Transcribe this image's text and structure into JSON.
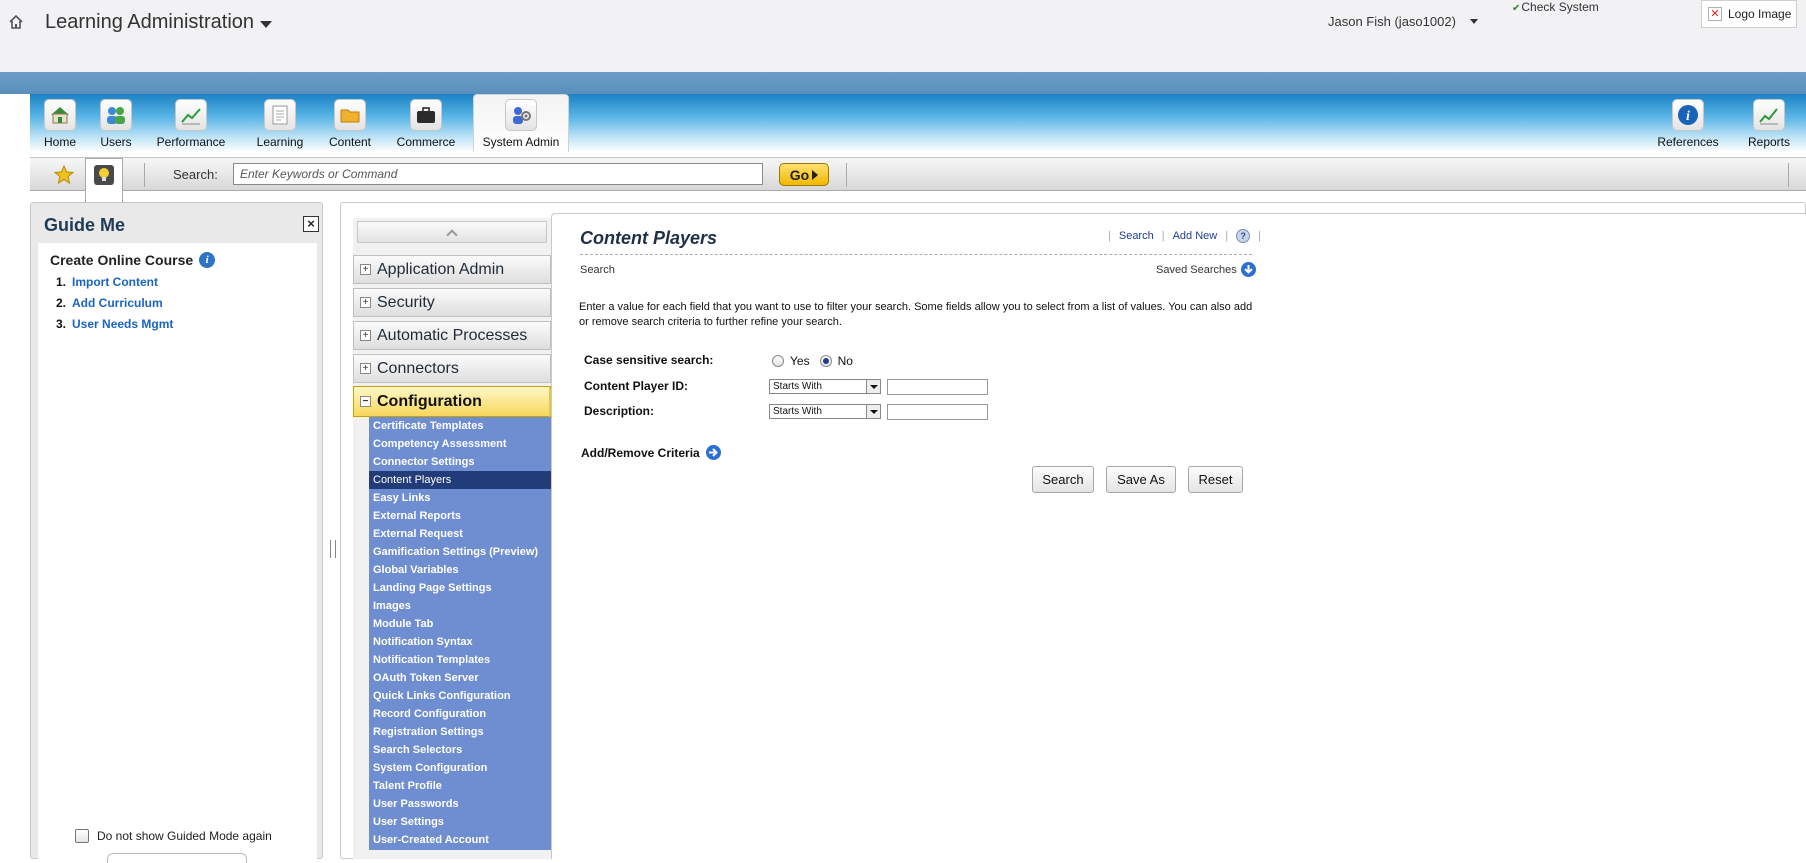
{
  "header": {
    "app_title": "Learning Administration",
    "user_name": "Jason Fish (jaso1002)",
    "check_system": "Check System",
    "logo_image": "Logo Image"
  },
  "nav": {
    "items": [
      {
        "label": "Home",
        "icon": "home-icon"
      },
      {
        "label": "Users",
        "icon": "users-icon"
      },
      {
        "label": "Performance",
        "icon": "performance-chart-icon"
      },
      {
        "label": "Learning",
        "icon": "document-icon"
      },
      {
        "label": "Content",
        "icon": "folder-icon"
      },
      {
        "label": "Commerce",
        "icon": "briefcase-icon"
      },
      {
        "label": "System Admin",
        "icon": "system-admin-icon"
      }
    ],
    "right_items": [
      {
        "label": "References",
        "icon": "info-icon"
      },
      {
        "label": "Reports",
        "icon": "reports-chart-icon"
      }
    ],
    "active": "System Admin"
  },
  "toolbar": {
    "search_label": "Search:",
    "search_placeholder": "Enter Keywords or Command",
    "go_label": "Go"
  },
  "guide": {
    "title": "Guide Me",
    "course_title": "Create Online Course",
    "steps": [
      {
        "num": "1.",
        "label": "Import Content"
      },
      {
        "num": "2.",
        "label": "Add Curriculum"
      },
      {
        "num": "3.",
        "label": "User Needs Mgmt"
      }
    ],
    "no_show_label": "Do not show Guided Mode again"
  },
  "sidebar": {
    "sections": [
      {
        "label": "Application Admin",
        "toggle": "+"
      },
      {
        "label": "Security",
        "toggle": "+"
      },
      {
        "label": "Automatic Processes",
        "toggle": "+"
      },
      {
        "label": "Connectors",
        "toggle": "+"
      },
      {
        "label": "Configuration",
        "toggle": "−"
      }
    ],
    "sub_items": [
      "Certificate Templates",
      "Competency Assessment",
      "Connector Settings",
      "Content Players",
      "Easy Links",
      "External Reports",
      "External Request",
      "Gamification Settings (Preview)",
      "Global Variables",
      "Landing Page Settings",
      "Images",
      "Module Tab",
      "Notification Syntax",
      "Notification Templates",
      "OAuth Token Server",
      "Quick Links Configuration",
      "Record Configuration",
      "Registration Settings",
      "Search Selectors",
      "System Configuration",
      "Talent Profile",
      "User Passwords",
      "User Settings",
      "User-Created Account"
    ],
    "current": "Content Players"
  },
  "content": {
    "title": "Content Players",
    "links": {
      "search": "Search",
      "add_new": "Add New",
      "help": "?"
    },
    "sub_label": "Search",
    "saved_searches": "Saved Searches",
    "instructions": "Enter a value for each field that you want to use to filter your search. Some fields allow you to select from a list of values. You can also add or remove search criteria to further refine your search.",
    "case_label": "Case sensitive search:",
    "yes_label": "Yes",
    "no_label": "No",
    "case_value": "No",
    "player_id_label": "Content Player ID:",
    "player_id_operator": "Starts With",
    "player_id_value": "",
    "description_label": "Description:",
    "description_operator": "Starts With",
    "description_value": "",
    "add_remove_label": "Add/Remove Criteria",
    "buttons": {
      "search": "Search",
      "save_as": "Save As",
      "reset": "Reset"
    }
  }
}
